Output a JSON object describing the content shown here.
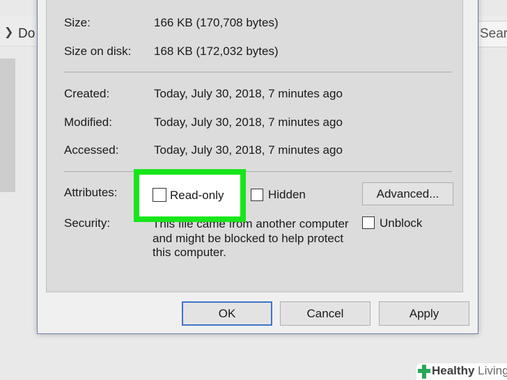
{
  "background": {
    "path_text": "Do",
    "search_text": "Searc"
  },
  "details": {
    "size_label": "Size:",
    "size_value": "166 KB (170,708 bytes)",
    "size_on_disk_label": "Size on disk:",
    "size_on_disk_value": "168 KB (172,032 bytes)",
    "created_label": "Created:",
    "created_value": "Today, July 30, 2018, 7 minutes ago",
    "modified_label": "Modified:",
    "modified_value": "Today, July 30, 2018, 7 minutes ago",
    "accessed_label": "Accessed:",
    "accessed_value": "Today, July 30, 2018, 7 minutes ago"
  },
  "attributes": {
    "label": "Attributes:",
    "readonly_label": "Read-only",
    "readonly_checked": false,
    "hidden_label": "Hidden",
    "hidden_checked": false,
    "advanced_label": "Advanced..."
  },
  "security": {
    "label": "Security:",
    "text": "This file came from another computer and might be blocked to help protect this computer.",
    "unblock_label": "Unblock",
    "unblock_checked": false
  },
  "buttons": {
    "ok": "OK",
    "cancel": "Cancel",
    "apply": "Apply"
  },
  "highlight_color": "#17e61a",
  "watermark": {
    "brand_1": "Healthy",
    "brand_2": " Living"
  }
}
